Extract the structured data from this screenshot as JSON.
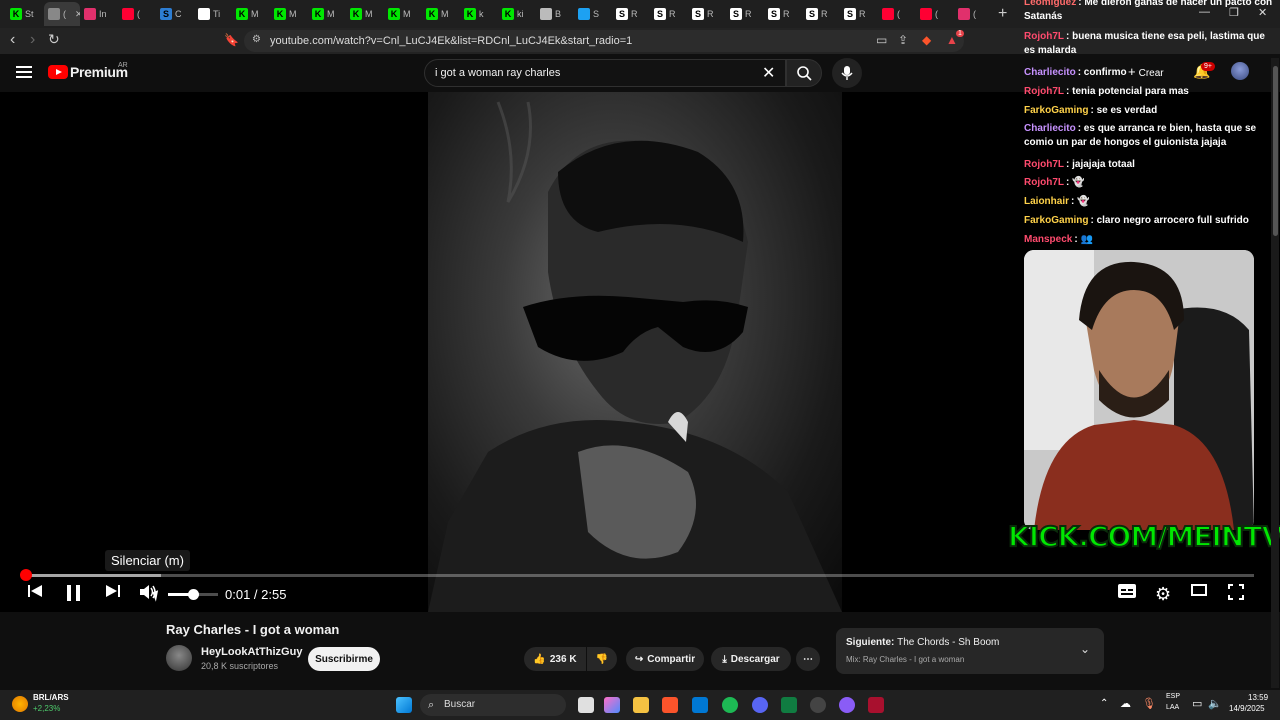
{
  "browser": {
    "tabs": [
      {
        "label": "St",
        "color": "#00e701",
        "icon": "K"
      },
      {
        "label": "(",
        "color": "#888888",
        "icon": "",
        "active": true
      },
      {
        "label": "In",
        "color": "#e1306c",
        "icon": ""
      },
      {
        "label": "(",
        "color": "#ff0033",
        "icon": ""
      },
      {
        "label": "C",
        "color": "#2d7dd2",
        "icon": "S"
      },
      {
        "label": "Ti",
        "color": "#ffffff",
        "icon": ""
      },
      {
        "label": "M",
        "color": "#00e701",
        "icon": "K"
      },
      {
        "label": "M",
        "color": "#00e701",
        "icon": "K"
      },
      {
        "label": "M",
        "color": "#00e701",
        "icon": "K"
      },
      {
        "label": "M",
        "color": "#00e701",
        "icon": "K"
      },
      {
        "label": "M",
        "color": "#00e701",
        "icon": "K"
      },
      {
        "label": "M",
        "color": "#00e701",
        "icon": "K"
      },
      {
        "label": "k",
        "color": "#00e701",
        "icon": "K"
      },
      {
        "label": "ki",
        "color": "#00e701",
        "icon": "K"
      },
      {
        "label": "B",
        "color": "#bbbbbb",
        "icon": ""
      },
      {
        "label": "S",
        "color": "#1da1f2",
        "icon": ""
      },
      {
        "label": "R",
        "color": "#ffffff",
        "icon": "S"
      },
      {
        "label": "R",
        "color": "#ffffff",
        "icon": "S"
      },
      {
        "label": "R",
        "color": "#ffffff",
        "icon": "S"
      },
      {
        "label": "R",
        "color": "#ffffff",
        "icon": "S"
      },
      {
        "label": "R",
        "color": "#ffffff",
        "icon": "S"
      },
      {
        "label": "R",
        "color": "#ffffff",
        "icon": "S"
      },
      {
        "label": "R",
        "color": "#ffffff",
        "icon": "S"
      },
      {
        "label": "(",
        "color": "#ff0033",
        "icon": ""
      },
      {
        "label": "(",
        "color": "#ff0033",
        "icon": ""
      },
      {
        "label": "(",
        "color": "#e1306c",
        "icon": ""
      }
    ],
    "url": "youtube.com/watch?v=Cnl_LuCJ4Ek&list=RDCnl_LuCJ4Ek&start_radio=1",
    "extension_badge": "1"
  },
  "youtube": {
    "logo_text": "Premium",
    "region": "AR",
    "search_value": "i got a woman ray charles",
    "create_label": "Crear",
    "notif_count": "9+"
  },
  "player": {
    "tooltip": "Silenciar (m)",
    "time": "0:01 / 2:55",
    "progress_fraction": 0.004,
    "buffer_fraction": 0.11,
    "volume_fraction": 0.5
  },
  "video": {
    "title": "Ray Charles - I got a woman",
    "channel": "HeyLookAtThizGuy",
    "subscribers": "20,8 K suscriptores",
    "subscribe_label": "Suscribirme",
    "likes": "236 K",
    "share_label": "Compartir",
    "download_label": "Descargar",
    "next_label_prefix": "Siguiente:",
    "next_title": "The Chords - Sh Boom",
    "next_mix": "Mix: Ray Charles - I got a woman"
  },
  "chat": {
    "messages": [
      {
        "user": "Leomiguez",
        "color": "#ff6b6b",
        "text": ": Me dieron ganas de hacer un pacto con Satanás"
      },
      {
        "user": "Rojoh7L",
        "color": "#ff4b6e",
        "text": ": buena musica tiene esa peli, lastima que es malarda"
      },
      {
        "user": "Charliecito",
        "color": "#c792ff",
        "text": ": confirmo"
      },
      {
        "user": "Rojoh7L",
        "color": "#ff4b6e",
        "text": ": tenia potencial para mas"
      },
      {
        "user": "FarkoGaming",
        "color": "#ffd24a",
        "text": ": se es verdad"
      },
      {
        "user": "Charliecito",
        "color": "#c792ff",
        "text": ": es que arranca re bien, hasta que se comio un par de hongos el guionista jajaja"
      },
      {
        "user": "Rojoh7L",
        "color": "#ff4b6e",
        "text": ": jajajaja totaal"
      },
      {
        "user": "Rojoh7L",
        "color": "#ff4b6e",
        "text": ": 👻"
      },
      {
        "user": "Laionhair",
        "color": "#ffd24a",
        "text": ": 👻"
      },
      {
        "user": "FarkoGaming",
        "color": "#ffd24a",
        "text": ": claro negro arrocero full sufrido"
      },
      {
        "user": "Manspeck",
        "color": "#ff4b6e",
        "text": ": 👥"
      }
    ],
    "overlay_text": "KICK.COM/MEINTV"
  },
  "taskbar": {
    "ticker": "BRL/ARS",
    "ticker_change": "+2,23%",
    "search_placeholder": "Buscar",
    "lang1": "ESP",
    "lang2": "LAA",
    "time": "13:59",
    "date": "14/9/2025"
  }
}
